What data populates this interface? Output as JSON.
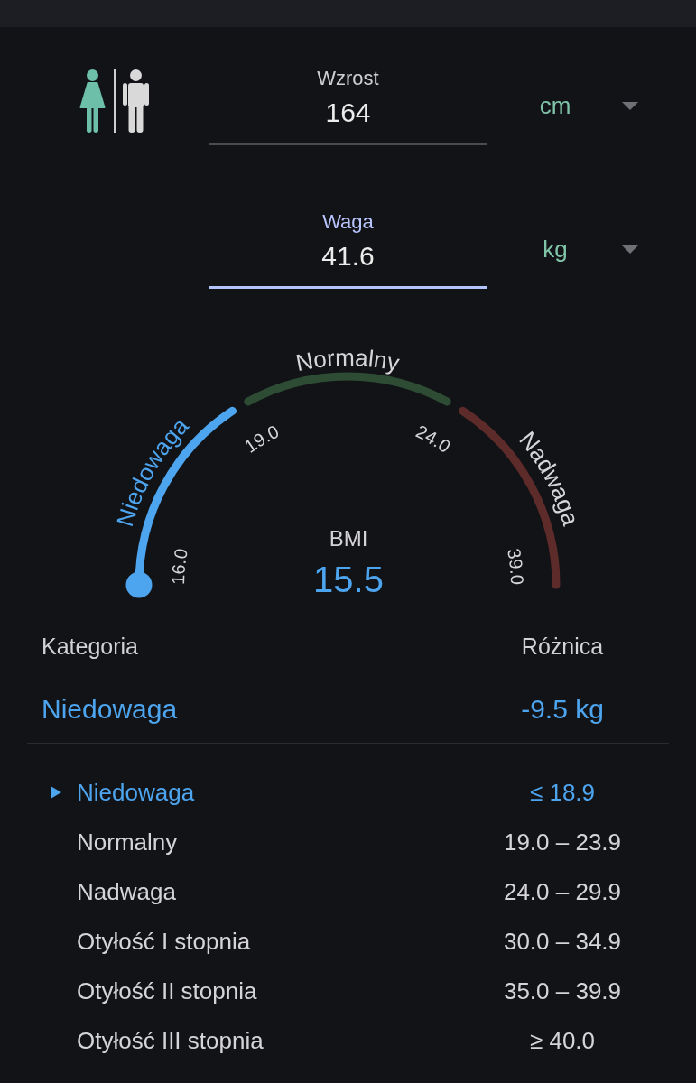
{
  "gender": [
    {
      "kind": "female",
      "selected": true
    },
    {
      "kind": "male",
      "selected": false
    }
  ],
  "fields": [
    {
      "label": "Wzrost",
      "value": "164",
      "unit": "cm",
      "focused": false
    },
    {
      "label": "Waga",
      "value": "41.6",
      "unit": "kg",
      "focused": true
    }
  ],
  "gauge": {
    "segments": [
      {
        "label": "Niedowaga",
        "color": "#4ea5ef",
        "selected": true
      },
      {
        "label": "Normalny",
        "color": "#2d4c33",
        "selected": false
      },
      {
        "label": "Nadwaga",
        "color": "#5d2b29",
        "selected": false
      }
    ],
    "ticks": [
      "16.0",
      "19.0",
      "24.0",
      "39.0"
    ],
    "title": "BMI",
    "value": "15.5",
    "level": 0
  },
  "result": {
    "category_heading": "Kategoria",
    "difference_heading": "Różnica",
    "category": "Niedowaga",
    "difference": "-9.5 kg"
  },
  "categories": [
    {
      "name": "Niedowaga",
      "range": "≤ 18.9",
      "selected": true
    },
    {
      "name": "Normalny",
      "range": "19.0 – 23.9",
      "selected": false
    },
    {
      "name": "Nadwaga",
      "range": "24.0 – 29.9",
      "selected": false
    },
    {
      "name": "Otyłość I stopnia",
      "range": "30.0 – 34.9",
      "selected": false
    },
    {
      "name": "Otyłość II stopnia",
      "range": "35.0 – 39.9",
      "selected": false
    },
    {
      "name": "Otyłość III stopnia",
      "range": "≥ 40.0",
      "selected": false
    }
  ]
}
